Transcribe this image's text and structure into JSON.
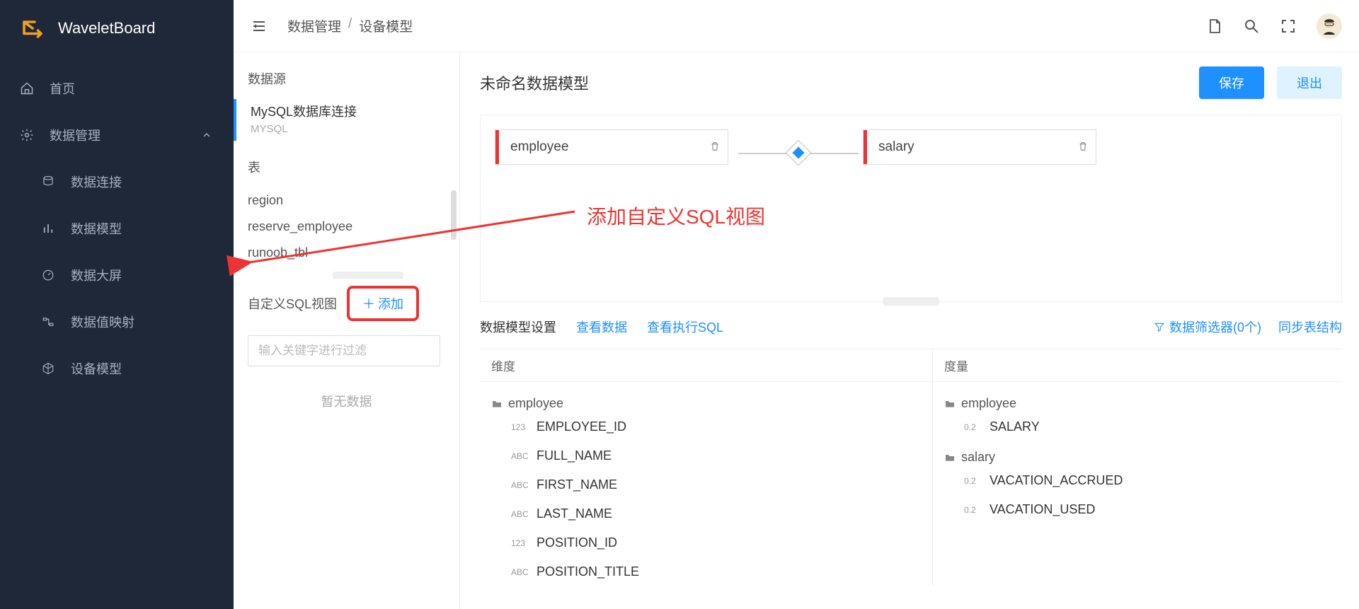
{
  "brand": {
    "name": "WaveletBoard"
  },
  "nav": {
    "home": "首页",
    "data_mgmt": "数据管理",
    "sub": {
      "conn": "数据连接",
      "model": "数据模型",
      "screen": "数据大屏",
      "valuemap": "数据值映射",
      "devmodel": "设备模型"
    }
  },
  "crumbs": {
    "a": "数据管理",
    "b": "设备模型"
  },
  "leftPanel": {
    "datasource_label": "数据源",
    "ds": {
      "name": "MySQL数据库连接",
      "type": "MYSQL"
    },
    "tables_label": "表",
    "tables": {
      "t0": "region",
      "t1": "reserve_employee",
      "t2": "runoob_tbl"
    },
    "sqlview_label": "自定义SQL视图",
    "add_label": "添加",
    "filter_placeholder": "输入关键字进行过滤",
    "no_data": "暂无数据"
  },
  "content": {
    "title": "未命名数据模型",
    "save": "保存",
    "exit": "退出",
    "box1": "employee",
    "box2": "salary",
    "annotation": "添加自定义SQL视图"
  },
  "tabs": {
    "settings": "数据模型设置",
    "view_data": "查看数据",
    "view_sql": "查看执行SQL",
    "filter": "数据筛选器(0个)",
    "sync": "同步表结构"
  },
  "fields": {
    "dim_label": "维度",
    "mea_label": "度量",
    "dim": {
      "group1": "employee",
      "f1": "EMPLOYEE_ID",
      "f2": "FULL_NAME",
      "f3": "FIRST_NAME",
      "f4": "LAST_NAME",
      "f5": "POSITION_ID",
      "f6": "POSITION_TITLE"
    },
    "mea": {
      "group1": "employee",
      "f1": "SALARY",
      "group2": "salary",
      "f2": "VACATION_ACCRUED",
      "f3": "VACATION_USED"
    }
  },
  "types": {
    "num": "123",
    "txt": "ABC",
    "dec": "0.2"
  }
}
